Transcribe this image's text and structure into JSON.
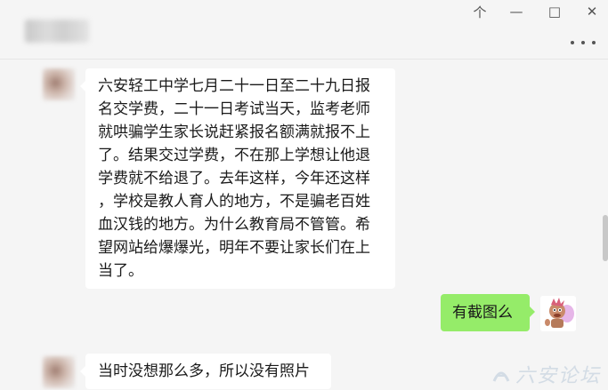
{
  "titlebar": {
    "controls": {
      "pin": "个",
      "minimize": "—",
      "maximize": "□",
      "close": "✕"
    },
    "more_icon": "more-dots-icon"
  },
  "messages": [
    {
      "side": "left",
      "lines": [
        "六安轻工中学七月二十一日至二十九日报",
        "名交学费，二十一日考试当天，监考老师",
        "就哄骗学生家长说赶紧报名额满就报不上",
        "了。结果交过学费，不在那上学想让他退",
        "学费就不给退了。去年这样，今年还这样",
        "，学校是教人育人的地方，不是骗老百姓",
        "血汉钱的地方。为什么教育局不管管。希",
        "望网站给爆爆光，明年不要让家长们在上",
        "当了。"
      ]
    },
    {
      "side": "right",
      "text": "有截图么"
    },
    {
      "side": "left",
      "text": "当时没想那么多，所以没有照片"
    }
  ],
  "watermark": {
    "text": "六安论坛"
  },
  "colors": {
    "background": "#f5f5f5",
    "bubble_left": "#ffffff",
    "bubble_right": "#95ec69"
  }
}
